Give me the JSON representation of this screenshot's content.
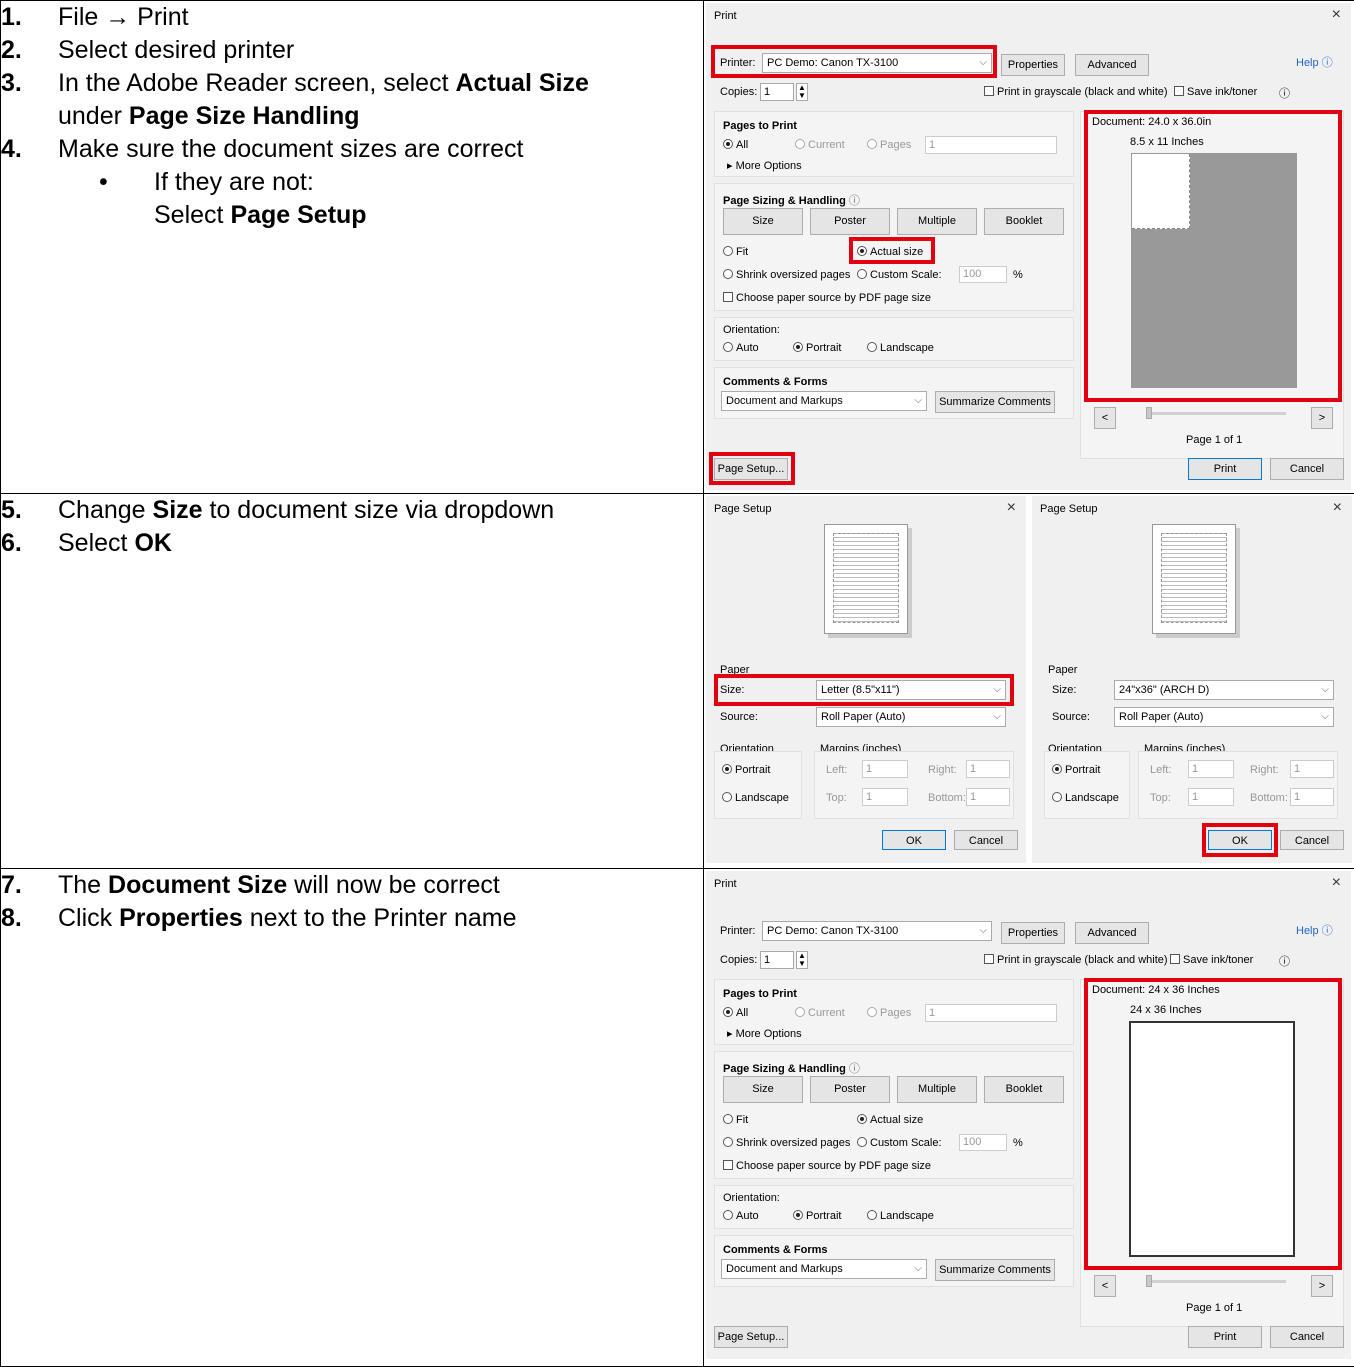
{
  "steps": {
    "s1": {
      "num": "1.",
      "pre": "File ",
      "arrow": "→",
      "post": " Print"
    },
    "s2": {
      "num": "2.",
      "text": "Select desired printer"
    },
    "s3": {
      "num": "3.",
      "pre": "In the Adobe Reader screen, select ",
      "b1": "Actual Size",
      "mid": "under ",
      "b2": "Page Size Handling"
    },
    "s4": {
      "num": "4.",
      "text": "Make sure the document sizes are correct"
    },
    "s4b": {
      "dot": "•",
      "line1": "If they are not:",
      "pre": "Select ",
      "b": "Page Setup"
    },
    "s5": {
      "num": "5.",
      "pre": "Change ",
      "b": "Size",
      "post": " to document size via dropdown"
    },
    "s6": {
      "num": "6.",
      "pre": "Select ",
      "b": "OK"
    },
    "s7": {
      "num": "7.",
      "pre": "The ",
      "b": "Document Size",
      "post": " will now be correct"
    },
    "s8": {
      "num": "8.",
      "pre": "Click ",
      "b": "Properties",
      "post": " next to the Printer name"
    }
  },
  "print1": {
    "title": "Print",
    "close": "×",
    "printer_label": "Printer:",
    "printer_value": "PC Demo: Canon TX-3100",
    "properties": "Properties",
    "advanced": "Advanced",
    "help": "Help",
    "copies_label": "Copies:",
    "copies_value": "1",
    "grayscale": "Print in grayscale (black and white)",
    "save_ink": "Save ink/toner",
    "pages_to_print": "Pages to Print",
    "all": "All",
    "current": "Current",
    "pages": "Pages",
    "pages_value": "1",
    "more_options": "More Options",
    "sizing": "Page Sizing & Handling",
    "size_btn": "Size",
    "poster_btn": "Poster",
    "multiple_btn": "Multiple",
    "booklet_btn": "Booklet",
    "fit": "Fit",
    "actual": "Actual size",
    "shrink": "Shrink oversized pages",
    "custom": "Custom Scale:",
    "scale_value": "100",
    "percent": "%",
    "choose_paper": "Choose paper source by PDF page size",
    "orientation": "Orientation:",
    "auto": "Auto",
    "portrait": "Portrait",
    "landscape": "Landscape",
    "comments_forms": "Comments & Forms",
    "comments_value": "Document and Markups",
    "summarize": "Summarize Comments",
    "doc_size": "Document: 24.0 x 36.0in",
    "paper_size": "8.5 x 11 Inches",
    "prev": "<",
    "next": ">",
    "page_of": "Page 1 of 1",
    "page_setup": "Page Setup...",
    "print": "Print",
    "cancel": "Cancel"
  },
  "setupA": {
    "title": "Page Setup",
    "close": "×",
    "paper": "Paper",
    "size_label": "Size:",
    "size_value": "Letter (8.5\"x11\")",
    "source_label": "Source:",
    "source_value": "Roll Paper (Auto)",
    "orientation": "Orientation",
    "portrait": "Portrait",
    "landscape": "Landscape",
    "margins": "Margins (inches)",
    "left": "Left:",
    "right": "Right:",
    "top": "Top:",
    "bottom": "Bottom:",
    "m_left": "1",
    "m_right": "1",
    "m_top": "1",
    "m_bottom": "1",
    "ok": "OK",
    "cancel": "Cancel"
  },
  "setupB": {
    "title": "Page Setup",
    "close": "×",
    "paper": "Paper",
    "size_label": "Size:",
    "size_value": "24\"x36\" (ARCH D)",
    "source_label": "Source:",
    "source_value": "Roll Paper (Auto)",
    "orientation": "Orientation",
    "portrait": "Portrait",
    "landscape": "Landscape",
    "margins": "Margins (inches)",
    "left": "Left:",
    "right": "Right:",
    "top": "Top:",
    "bottom": "Bottom:",
    "m_left": "1",
    "m_right": "1",
    "m_top": "1",
    "m_bottom": "1",
    "ok": "OK",
    "cancel": "Cancel"
  },
  "print2": {
    "title": "Print",
    "close": "×",
    "printer_label": "Printer:",
    "printer_value": "PC Demo: Canon TX-3100",
    "properties": "Properties",
    "advanced": "Advanced",
    "help": "Help",
    "copies_label": "Copies:",
    "copies_value": "1",
    "grayscale": "Print in grayscale (black and white)",
    "save_ink": "Save ink/toner",
    "pages_to_print": "Pages to Print",
    "all": "All",
    "current": "Current",
    "pages": "Pages",
    "pages_value": "1",
    "more_options": "More Options",
    "sizing": "Page Sizing & Handling",
    "size_btn": "Size",
    "poster_btn": "Poster",
    "multiple_btn": "Multiple",
    "booklet_btn": "Booklet",
    "fit": "Fit",
    "actual": "Actual size",
    "shrink": "Shrink oversized pages",
    "custom": "Custom Scale:",
    "scale_value": "100",
    "percent": "%",
    "choose_paper": "Choose paper source by PDF page size",
    "orientation": "Orientation:",
    "auto": "Auto",
    "portrait": "Portrait",
    "landscape": "Landscape",
    "comments_forms": "Comments & Forms",
    "comments_value": "Document and Markups",
    "summarize": "Summarize Comments",
    "doc_size": "Document: 24 x 36 Inches",
    "paper_size": "24 x 36 Inches",
    "prev": "<",
    "next": ">",
    "page_of": "Page 1 of 1",
    "page_setup": "Page Setup...",
    "print": "Print",
    "cancel": "Cancel"
  },
  "colors": {
    "highlight": "#e3000f",
    "dialog_bg": "#f0f0f0",
    "preview_gray": "#999999"
  }
}
